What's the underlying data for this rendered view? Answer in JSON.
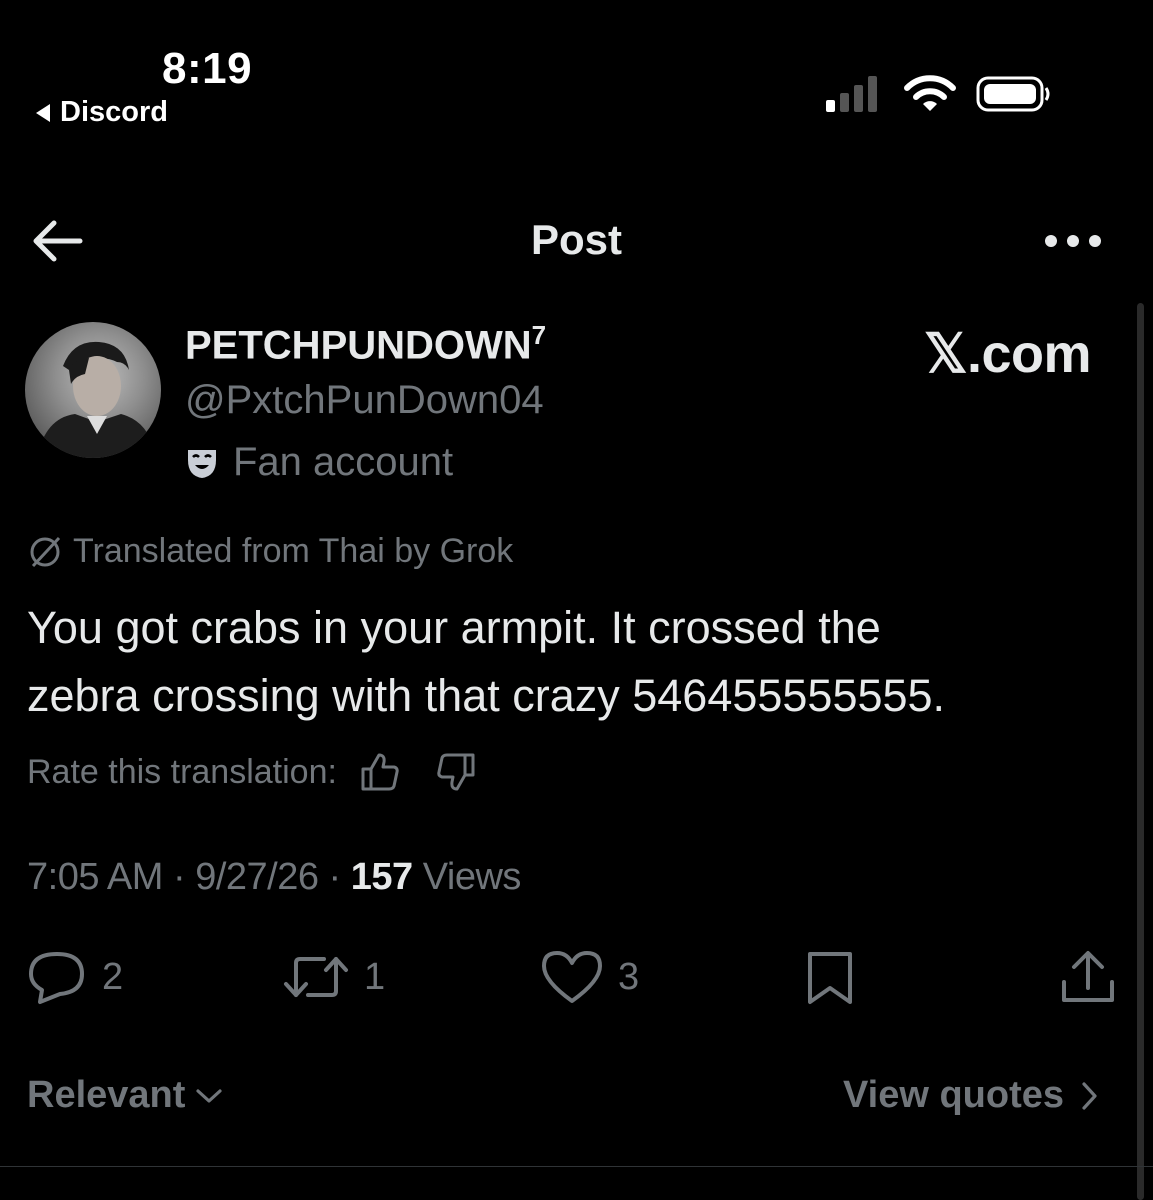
{
  "status_bar": {
    "time": "8:19",
    "back_app": "Discord"
  },
  "header": {
    "title": "Post"
  },
  "author": {
    "display_name": "PETCHPUNDOWN",
    "display_name_sup": "7",
    "handle": "@PxtchPunDown04",
    "label": "Fan account"
  },
  "watermark": "𝕏.com",
  "translation": {
    "source_note": "Translated from Thai by Grok",
    "text": "You got crabs in your armpit. It crossed the\nzebra crossing with that crazy 546455555555.",
    "rate_label": "Rate this translation:"
  },
  "meta": {
    "time": "7:05 AM",
    "date": "9/27/26",
    "views_count": "157",
    "views_label": "Views",
    "sep": " · "
  },
  "actions": {
    "replies": "2",
    "reposts": "1",
    "likes": "3"
  },
  "footer": {
    "sort_label": "Relevant",
    "quotes_label": "View quotes"
  },
  "colors": {
    "background": "#000000",
    "primary_text": "#e7e9ea",
    "secondary_text": "#71767b"
  },
  "icons": [
    "chevron-left-icon",
    "cellular-signal-icon",
    "wifi-icon",
    "battery-icon",
    "arrow-left-icon",
    "more-icon",
    "fan-mask-icon",
    "translate-slash-icon",
    "thumbs-up-icon",
    "thumbs-down-icon",
    "reply-icon",
    "repost-icon",
    "like-icon",
    "bookmark-icon",
    "share-icon",
    "chevron-down-icon",
    "chevron-right-icon"
  ]
}
